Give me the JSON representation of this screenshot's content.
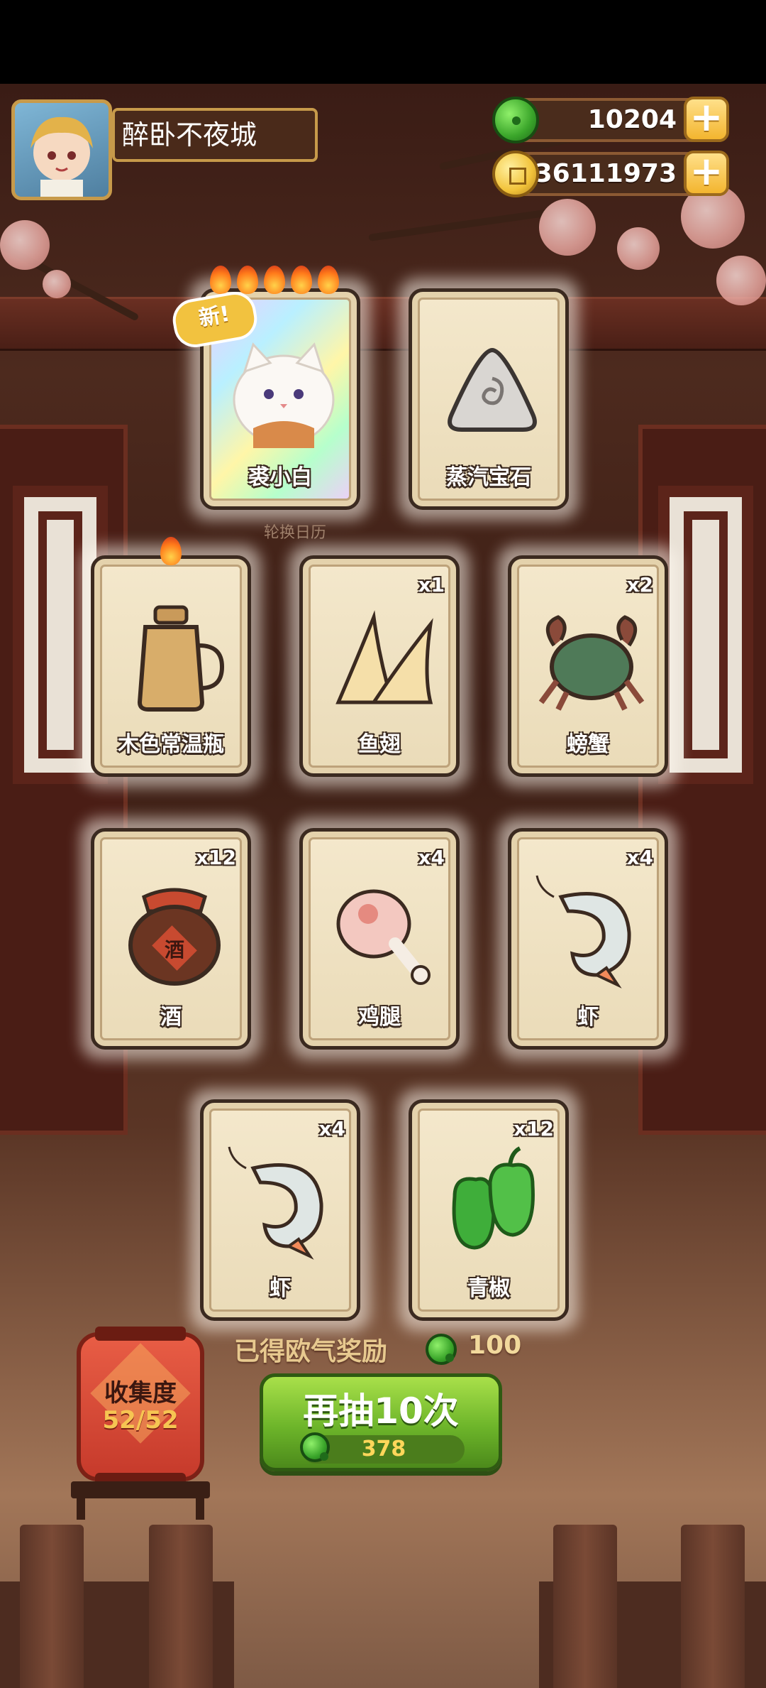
{
  "player": {
    "name": "醉卧不夜城"
  },
  "currencies": {
    "jade": {
      "value": "10204",
      "icon": "jade-icon"
    },
    "gold": {
      "value": "36111973",
      "icon": "gold-coin-icon"
    },
    "plus": "+"
  },
  "featured": {
    "new_tag": "新!",
    "sub_label": "轮换日历",
    "cards": [
      {
        "label": "裘小白",
        "stars": 5
      },
      {
        "label": "蒸汽宝石"
      }
    ]
  },
  "items": [
    {
      "label": "木色常温瓶",
      "count": "",
      "flames": 1
    },
    {
      "label": "鱼翅",
      "count": "x1"
    },
    {
      "label": "螃蟹",
      "count": "x2"
    },
    {
      "label": "酒",
      "count": "x12"
    },
    {
      "label": "鸡腿",
      "count": "x4"
    },
    {
      "label": "虾",
      "count": "x4"
    },
    {
      "label": "虾",
      "count": "x4"
    },
    {
      "label": "青椒",
      "count": "x12"
    }
  ],
  "reward": {
    "label": "已得欧气奖励",
    "amount": "100"
  },
  "draw_button": {
    "label": "再抽10次",
    "cost": "378"
  },
  "collection": {
    "label": "收集度",
    "progress": "52/52"
  },
  "jar_text": "酒"
}
